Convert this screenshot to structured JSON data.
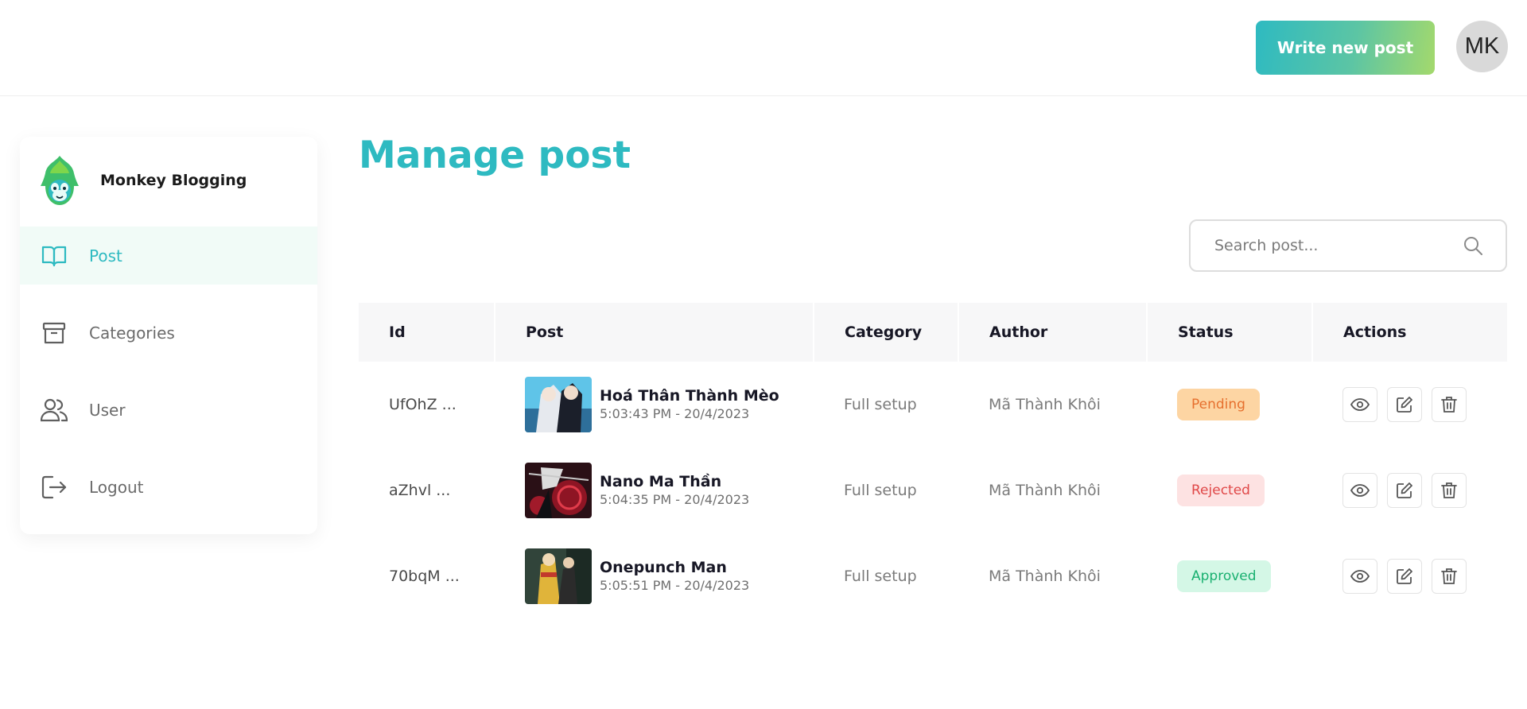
{
  "header": {
    "write_button": "Write new post",
    "avatar_initials": "MK"
  },
  "sidebar": {
    "brand": "Monkey Blogging",
    "items": [
      {
        "label": "Post",
        "icon": "book-open-icon",
        "active": true
      },
      {
        "label": "Categories",
        "icon": "archive-icon",
        "active": false
      },
      {
        "label": "User",
        "icon": "users-icon",
        "active": false
      },
      {
        "label": "Logout",
        "icon": "logout-icon",
        "active": false
      }
    ]
  },
  "main": {
    "title": "Manage post",
    "search": {
      "placeholder": "Search post..."
    },
    "table": {
      "columns": [
        "Id",
        "Post",
        "Category",
        "Author",
        "Status",
        "Actions"
      ],
      "rows": [
        {
          "id": "UfOhZ ...",
          "title": "Hoá Thân Thành Mèo",
          "date": "5:03:43 PM - 20/4/2023",
          "category": "Full setup",
          "author": "Mã Thành Khôi",
          "status": "Pending"
        },
        {
          "id": "aZhvl ...",
          "title": "Nano Ma Thần",
          "date": "5:04:35 PM - 20/4/2023",
          "category": "Full setup",
          "author": "Mã Thành Khôi",
          "status": "Rejected"
        },
        {
          "id": "70bqM ...",
          "title": "Onepunch Man",
          "date": "5:05:51 PM - 20/4/2023",
          "category": "Full setup",
          "author": "Mã Thành Khôi",
          "status": "Approved"
        }
      ]
    }
  },
  "colors": {
    "accent": "#2ebac1",
    "pending_bg": "#fdd5a3",
    "pending_text": "#e6702e",
    "rejected_bg": "#fde2e2",
    "rejected_text": "#e04848",
    "approved_bg": "#d4f7e6",
    "approved_text": "#19b070"
  }
}
